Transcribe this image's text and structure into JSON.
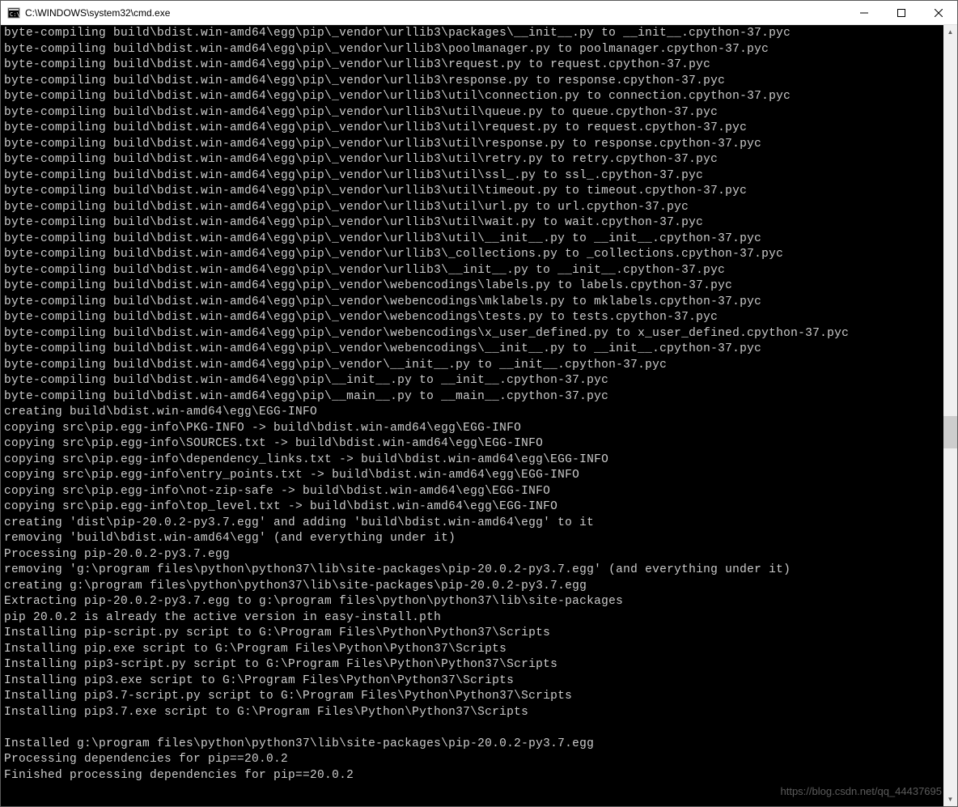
{
  "window": {
    "title": "C:\\WINDOWS\\system32\\cmd.exe"
  },
  "terminal": {
    "lines": [
      "byte-compiling build\\bdist.win-amd64\\egg\\pip\\_vendor\\urllib3\\packages\\__init__.py to __init__.cpython-37.pyc",
      "byte-compiling build\\bdist.win-amd64\\egg\\pip\\_vendor\\urllib3\\poolmanager.py to poolmanager.cpython-37.pyc",
      "byte-compiling build\\bdist.win-amd64\\egg\\pip\\_vendor\\urllib3\\request.py to request.cpython-37.pyc",
      "byte-compiling build\\bdist.win-amd64\\egg\\pip\\_vendor\\urllib3\\response.py to response.cpython-37.pyc",
      "byte-compiling build\\bdist.win-amd64\\egg\\pip\\_vendor\\urllib3\\util\\connection.py to connection.cpython-37.pyc",
      "byte-compiling build\\bdist.win-amd64\\egg\\pip\\_vendor\\urllib3\\util\\queue.py to queue.cpython-37.pyc",
      "byte-compiling build\\bdist.win-amd64\\egg\\pip\\_vendor\\urllib3\\util\\request.py to request.cpython-37.pyc",
      "byte-compiling build\\bdist.win-amd64\\egg\\pip\\_vendor\\urllib3\\util\\response.py to response.cpython-37.pyc",
      "byte-compiling build\\bdist.win-amd64\\egg\\pip\\_vendor\\urllib3\\util\\retry.py to retry.cpython-37.pyc",
      "byte-compiling build\\bdist.win-amd64\\egg\\pip\\_vendor\\urllib3\\util\\ssl_.py to ssl_.cpython-37.pyc",
      "byte-compiling build\\bdist.win-amd64\\egg\\pip\\_vendor\\urllib3\\util\\timeout.py to timeout.cpython-37.pyc",
      "byte-compiling build\\bdist.win-amd64\\egg\\pip\\_vendor\\urllib3\\util\\url.py to url.cpython-37.pyc",
      "byte-compiling build\\bdist.win-amd64\\egg\\pip\\_vendor\\urllib3\\util\\wait.py to wait.cpython-37.pyc",
      "byte-compiling build\\bdist.win-amd64\\egg\\pip\\_vendor\\urllib3\\util\\__init__.py to __init__.cpython-37.pyc",
      "byte-compiling build\\bdist.win-amd64\\egg\\pip\\_vendor\\urllib3\\_collections.py to _collections.cpython-37.pyc",
      "byte-compiling build\\bdist.win-amd64\\egg\\pip\\_vendor\\urllib3\\__init__.py to __init__.cpython-37.pyc",
      "byte-compiling build\\bdist.win-amd64\\egg\\pip\\_vendor\\webencodings\\labels.py to labels.cpython-37.pyc",
      "byte-compiling build\\bdist.win-amd64\\egg\\pip\\_vendor\\webencodings\\mklabels.py to mklabels.cpython-37.pyc",
      "byte-compiling build\\bdist.win-amd64\\egg\\pip\\_vendor\\webencodings\\tests.py to tests.cpython-37.pyc",
      "byte-compiling build\\bdist.win-amd64\\egg\\pip\\_vendor\\webencodings\\x_user_defined.py to x_user_defined.cpython-37.pyc",
      "byte-compiling build\\bdist.win-amd64\\egg\\pip\\_vendor\\webencodings\\__init__.py to __init__.cpython-37.pyc",
      "byte-compiling build\\bdist.win-amd64\\egg\\pip\\_vendor\\__init__.py to __init__.cpython-37.pyc",
      "byte-compiling build\\bdist.win-amd64\\egg\\pip\\__init__.py to __init__.cpython-37.pyc",
      "byte-compiling build\\bdist.win-amd64\\egg\\pip\\__main__.py to __main__.cpython-37.pyc",
      "creating build\\bdist.win-amd64\\egg\\EGG-INFO",
      "copying src\\pip.egg-info\\PKG-INFO -> build\\bdist.win-amd64\\egg\\EGG-INFO",
      "copying src\\pip.egg-info\\SOURCES.txt -> build\\bdist.win-amd64\\egg\\EGG-INFO",
      "copying src\\pip.egg-info\\dependency_links.txt -> build\\bdist.win-amd64\\egg\\EGG-INFO",
      "copying src\\pip.egg-info\\entry_points.txt -> build\\bdist.win-amd64\\egg\\EGG-INFO",
      "copying src\\pip.egg-info\\not-zip-safe -> build\\bdist.win-amd64\\egg\\EGG-INFO",
      "copying src\\pip.egg-info\\top_level.txt -> build\\bdist.win-amd64\\egg\\EGG-INFO",
      "creating 'dist\\pip-20.0.2-py3.7.egg' and adding 'build\\bdist.win-amd64\\egg' to it",
      "removing 'build\\bdist.win-amd64\\egg' (and everything under it)",
      "Processing pip-20.0.2-py3.7.egg",
      "removing 'g:\\program files\\python\\python37\\lib\\site-packages\\pip-20.0.2-py3.7.egg' (and everything under it)",
      "creating g:\\program files\\python\\python37\\lib\\site-packages\\pip-20.0.2-py3.7.egg",
      "Extracting pip-20.0.2-py3.7.egg to g:\\program files\\python\\python37\\lib\\site-packages",
      "pip 20.0.2 is already the active version in easy-install.pth",
      "Installing pip-script.py script to G:\\Program Files\\Python\\Python37\\Scripts",
      "Installing pip.exe script to G:\\Program Files\\Python\\Python37\\Scripts",
      "Installing pip3-script.py script to G:\\Program Files\\Python\\Python37\\Scripts",
      "Installing pip3.exe script to G:\\Program Files\\Python\\Python37\\Scripts",
      "Installing pip3.7-script.py script to G:\\Program Files\\Python\\Python37\\Scripts",
      "Installing pip3.7.exe script to G:\\Program Files\\Python\\Python37\\Scripts",
      "",
      "Installed g:\\program files\\python\\python37\\lib\\site-packages\\pip-20.0.2-py3.7.egg",
      "Processing dependencies for pip==20.0.2",
      "Finished processing dependencies for pip==20.0.2"
    ]
  },
  "watermark": "https://blog.csdn.net/qq_44437695"
}
